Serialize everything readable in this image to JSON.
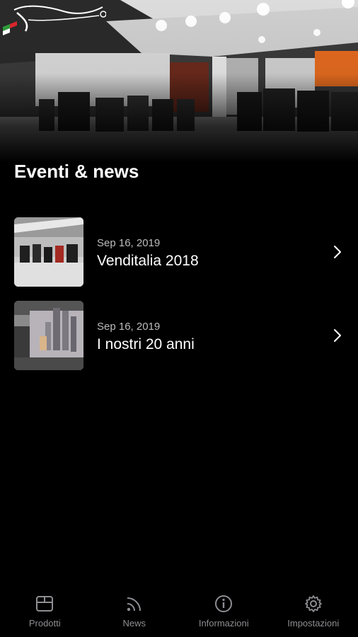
{
  "page": {
    "title": "Eventi & news"
  },
  "news": [
    {
      "date": "Sep 16, 2019",
      "title": "Venditalia 2018",
      "thumb_icon": "venditalia-photo"
    },
    {
      "date": "Sep 16, 2019",
      "title": "I nostri 20 anni",
      "thumb_icon": "anniversary-photo"
    }
  ],
  "tabs": [
    {
      "label": "Prodotti",
      "icon": "box-icon"
    },
    {
      "label": "News",
      "icon": "rss-icon"
    },
    {
      "label": "Informazioni",
      "icon": "info-icon"
    },
    {
      "label": "Impostazioni",
      "icon": "gear-icon"
    }
  ],
  "colors": {
    "background": "#000000",
    "text": "#ffffff",
    "date_text": "#bdbdbd",
    "tab_inactive": "#8e8e93"
  }
}
